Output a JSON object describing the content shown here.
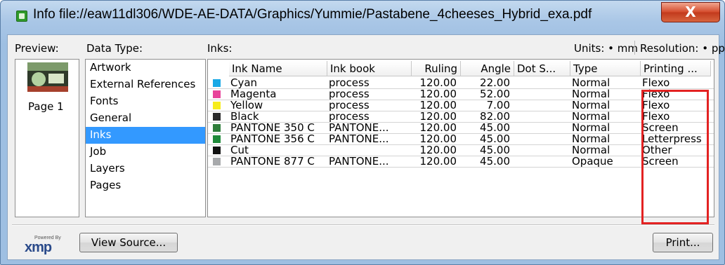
{
  "window": {
    "title": "Info file://eaw11dl306/WDE-AE-DATA/Graphics/Yummie/Pastabene_4cheeses_Hybrid_exa.pdf",
    "close_glyph": "X"
  },
  "labels": {
    "preview": "Preview:",
    "data_type": "Data Type:",
    "inks": "Inks:",
    "units": "Units: • mm",
    "resolution": "Resolution: • ppi"
  },
  "preview": {
    "page_label": "Page 1"
  },
  "data_types": [
    "Artwork",
    "External References",
    "Fonts",
    "General",
    "Inks",
    "Job",
    "Layers",
    "Pages"
  ],
  "selected_data_type": "Inks",
  "inks": {
    "columns": [
      "Ink Name",
      "Ink book",
      "Ruling",
      "Angle",
      "Dot S...",
      "Type",
      "Printing ..."
    ],
    "rows": [
      {
        "color": "#19a9e6",
        "name": "Cyan",
        "book": "process",
        "ruling": "120.00",
        "angle": "22.00",
        "dot": "",
        "type": "Normal",
        "printing": "Flexo"
      },
      {
        "color": "#e8439a",
        "name": "Magenta",
        "book": "process",
        "ruling": "120.00",
        "angle": "52.00",
        "dot": "",
        "type": "Normal",
        "printing": "Flexo"
      },
      {
        "color": "#f6ec1c",
        "name": "Yellow",
        "book": "process",
        "ruling": "120.00",
        "angle": "7.00",
        "dot": "",
        "type": "Normal",
        "printing": "Flexo"
      },
      {
        "color": "#2a2a2a",
        "name": "Black",
        "book": "process",
        "ruling": "120.00",
        "angle": "82.00",
        "dot": "",
        "type": "Normal",
        "printing": "Flexo"
      },
      {
        "color": "#2e7d3a",
        "name": "PANTONE 350 C",
        "book": "PANTONE...",
        "ruling": "120.00",
        "angle": "45.00",
        "dot": "",
        "type": "Normal",
        "printing": "Screen"
      },
      {
        "color": "#1f8a3a",
        "name": "PANTONE 356 C",
        "book": "PANTONE...",
        "ruling": "120.00",
        "angle": "45.00",
        "dot": "",
        "type": "Normal",
        "printing": "Letterpress"
      },
      {
        "color": "#111111",
        "name": "Cut",
        "book": "",
        "ruling": "120.00",
        "angle": "45.00",
        "dot": "",
        "type": "Normal",
        "printing": "Other"
      },
      {
        "color": "#a7a9ab",
        "name": "PANTONE 877 C",
        "book": "PANTONE...",
        "ruling": "120.00",
        "angle": "45.00",
        "dot": "",
        "type": "Opaque",
        "printing": "Screen"
      }
    ]
  },
  "footer": {
    "logo_small": "Powered By",
    "logo_big": "xmp",
    "view_source": "View Source...",
    "print": "Print..."
  }
}
